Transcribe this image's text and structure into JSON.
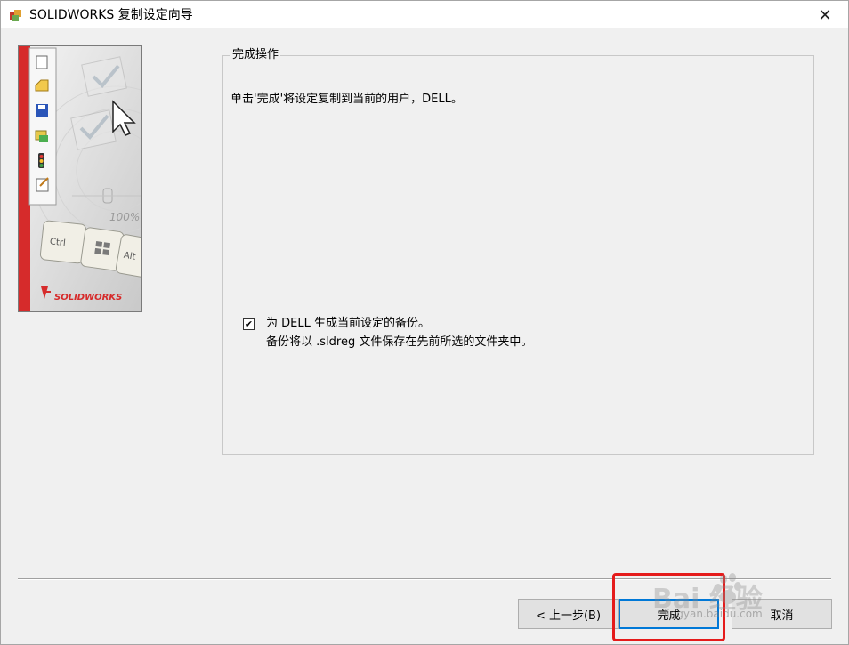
{
  "window": {
    "title": "SOLIDWORKS 复制设定向导",
    "close_label": "✕"
  },
  "sidebar": {
    "brand": "SOLIDWORKS",
    "keys": [
      "Ctrl",
      "",
      "Alt"
    ],
    "zoom_text": "100%"
  },
  "group": {
    "title": "完成操作",
    "instruction": "单击'完成'将设定复制到当前的用户，DELL。",
    "checkbox": {
      "checked": true,
      "mark": "✔",
      "label": "为 DELL 生成当前设定的备份。",
      "sublabel": "备份将以 .sldreg 文件保存在先前所选的文件夹中。"
    }
  },
  "buttons": {
    "back": "< 上一步(B)",
    "finish": "完成",
    "cancel": "取消"
  },
  "watermark": {
    "text": "Bai  经验",
    "url": "jingyan.baidu.com"
  },
  "colors": {
    "accent_red": "#d62b2b",
    "focus_blue": "#0078d7",
    "highlight_red": "#e51b1b"
  }
}
